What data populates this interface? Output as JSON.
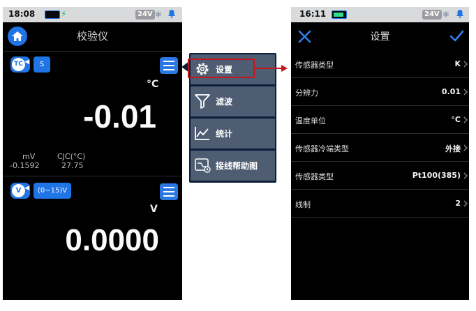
{
  "left_screen": {
    "status_bar": {
      "time": "18:08",
      "voltage": "24V"
    },
    "header": {
      "title": "校验仪"
    },
    "channel1": {
      "sensor_badge": "TC",
      "type_chip": "S",
      "unit": "°C",
      "value": "-0.01",
      "mv_label": "mV",
      "mv_value": "-0.1592",
      "cjc_label": "CJC(°C)",
      "cjc_value": "27.75"
    },
    "channel2": {
      "sensor_badge": "V",
      "range_chip": "(0~15)V",
      "unit": "V",
      "value": "0.0000"
    }
  },
  "popup_menu": {
    "items": [
      {
        "label": "设置",
        "icon": "gear-icon"
      },
      {
        "label": "滤波",
        "icon": "filter-icon"
      },
      {
        "label": "统计",
        "icon": "line-chart-icon"
      },
      {
        "label": "接线帮助图",
        "icon": "wiring-diagram-icon"
      }
    ]
  },
  "right_screen": {
    "status_bar": {
      "time": "16:11",
      "voltage": "24V"
    },
    "header": {
      "title": "设置"
    },
    "rows": [
      {
        "label": "传感器类型",
        "value": "K"
      },
      {
        "label": "分辨力",
        "value": "0.01"
      },
      {
        "label": "温度单位",
        "value": "°C"
      },
      {
        "label": "传感器冷端类型",
        "value": "外接"
      },
      {
        "label": "传感器类型",
        "value": "Pt100(385)"
      },
      {
        "label": "线制",
        "value": "2"
      }
    ]
  },
  "colors": {
    "accent": "#1f74e6",
    "menu_item_bg": "#4f5d72",
    "highlight": "#c4151c",
    "battery_green": "#2ee08a"
  }
}
